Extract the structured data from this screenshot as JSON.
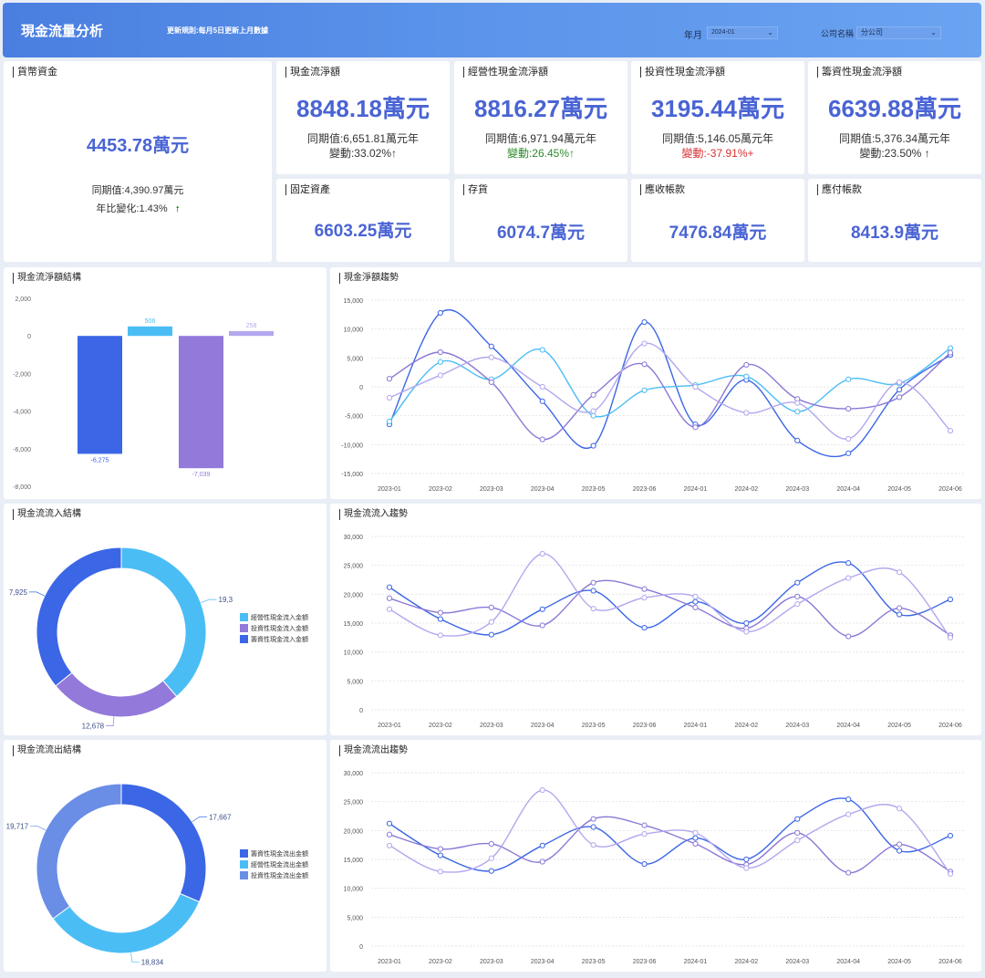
{
  "header": {
    "title": "現金流量分析",
    "update_rule": "更新規則:每月5日更新上月數據",
    "filters": {
      "month_label": "年月",
      "month_value": "2024-01",
      "company_label": "公司名稱",
      "company_value": "分公司"
    }
  },
  "kpis": {
    "cash": {
      "title": "貨幣資金",
      "value": "4453.78萬元",
      "prior": "同期值:4,390.97萬元",
      "change": "年比變化:1.43%",
      "arrow": "🠕"
    },
    "net": {
      "title": "現金流淨額",
      "value": "8848.18萬元",
      "prior": "同期值:6,651.81萬元年",
      "change": "變動:33.02%↑"
    },
    "operating": {
      "title": "經營性現金流淨額",
      "value": "8816.27萬元",
      "prior": "同期值:6,971.94萬元年",
      "change": "變動:26.45%↑"
    },
    "investing": {
      "title": "投資性現金流淨額",
      "value": "3195.44萬元",
      "prior": "同期值:5,146.05萬元年",
      "change": "變動:-37.91%+"
    },
    "financing": {
      "title": "籌資性現金流淨額",
      "value": "6639.88萬元",
      "prior": "同期值:5,376.34萬元年",
      "change": "變動:23.50% ↑"
    },
    "fixed": {
      "title": "固定資產",
      "value": "6603.25萬元"
    },
    "inventory": {
      "title": "存貨",
      "value": "6074.7萬元"
    },
    "receivable": {
      "title": "應收帳款",
      "value": "7476.84萬元"
    },
    "payable": {
      "title": "應付帳款",
      "value": "8413.9萬元"
    }
  },
  "panels": {
    "net_structure": "現金流淨額結構",
    "net_trend": "現金淨額趨勢",
    "inflow_structure": "現金流流入結構",
    "inflow_trend": "現金流流入趨勢",
    "outflow_structure": "現金流流出結構",
    "outflow_trend": "現金流流出趨勢"
  },
  "colors": {
    "blue": "#3b66e6",
    "cyan": "#4bbdf5",
    "purple": "#9279da",
    "lavender": "#b3a7ee",
    "steel": "#6a8ee6"
  },
  "chart_data": [
    {
      "id": "net_structure",
      "type": "bar",
      "values": [
        -6275,
        506,
        -7039,
        258
      ],
      "labels": [
        "-6,275",
        "506",
        "-7,039",
        "258"
      ],
      "colors": [
        "#3b66e6",
        "#4bbdf5",
        "#9279da",
        "#b3a7ee"
      ],
      "yticks": [
        "2,000",
        "0",
        "-2,000",
        "-4,000",
        "-6,000",
        "-8,000"
      ],
      "ylim": [
        -8000,
        2000
      ]
    },
    {
      "id": "net_trend",
      "type": "line",
      "x": [
        "2023-01",
        "2023-02",
        "2023-03",
        "2023-04",
        "2023-05",
        "2023-06",
        "2024-01",
        "2024-02",
        "2024-03",
        "2024-04",
        "2024-05",
        "2024-06"
      ],
      "ylim": [
        -15000,
        15000
      ],
      "yticks": [
        "15,000",
        "10,000",
        "5,000",
        "0",
        "-5,000",
        "-10,000",
        "-15,000"
      ],
      "series": [
        {
          "color": "#3b66e6",
          "values": [
            -6500,
            12800,
            7000,
            -2500,
            -10200,
            11200,
            -6500,
            1200,
            -9300,
            -11500,
            -500,
            5500
          ]
        },
        {
          "color": "#4bbdf5",
          "values": [
            -6000,
            4300,
            1300,
            6400,
            -5000,
            -600,
            300,
            1800,
            -4300,
            1300,
            600,
            6700
          ]
        },
        {
          "color": "#8a78d6",
          "values": [
            1400,
            6000,
            800,
            -9100,
            -1400,
            3900,
            -7000,
            3800,
            -2100,
            -3800,
            -1800,
            5900
          ]
        },
        {
          "color": "#b3a7ee",
          "values": [
            -1900,
            2000,
            5100,
            0,
            -4200,
            7500,
            0,
            -4500,
            -2800,
            -9000,
            800,
            -7600
          ]
        }
      ]
    },
    {
      "id": "inflow_structure",
      "type": "pie",
      "values": [
        19300,
        12678,
        17925
      ],
      "labels": [
        "19,3",
        "12,678",
        "7,925"
      ],
      "colors": [
        "#4bbdf5",
        "#9279da",
        "#3b66e6"
      ],
      "legend": [
        "經營性現金流入金額",
        "投資性現金流入金額",
        "籌資性現金流入金額"
      ]
    },
    {
      "id": "inflow_trend",
      "type": "line",
      "x": [
        "2023-01",
        "2023-02",
        "2023-03",
        "2023-04",
        "2023-05",
        "2023-06",
        "2024-01",
        "2024-02",
        "2024-03",
        "2024-04",
        "2024-05",
        "2024-06"
      ],
      "ylim": [
        0,
        30000
      ],
      "yticks": [
        "30,000",
        "25,000",
        "20,000",
        "15,000",
        "10,000",
        "5,000",
        "0"
      ],
      "series": [
        {
          "color": "#3b66e6",
          "values": [
            21200,
            15700,
            13000,
            17400,
            20600,
            14200,
            18700,
            15000,
            22000,
            25400,
            16500,
            19100
          ]
        },
        {
          "color": "#8a78d6",
          "values": [
            19300,
            16800,
            17700,
            14600,
            22000,
            20900,
            17700,
            14100,
            19600,
            12700,
            17600,
            12900
          ]
        },
        {
          "color": "#b3a7ee",
          "values": [
            17400,
            12900,
            15200,
            27000,
            17500,
            19400,
            19600,
            13500,
            18300,
            22800,
            23800,
            12500
          ]
        }
      ]
    },
    {
      "id": "outflow_structure",
      "type": "pie",
      "values": [
        17667,
        18834,
        19717
      ],
      "labels": [
        "17,667",
        "18,834",
        "19,717"
      ],
      "colors": [
        "#3b66e6",
        "#4bbdf5",
        "#6a8ee6"
      ],
      "legend": [
        "籌資性現金流出金額",
        "經營性現金流出金額",
        "投資性現金流出金額"
      ]
    },
    {
      "id": "outflow_trend",
      "type": "line",
      "x": [
        "2023-01",
        "2023-02",
        "2023-03",
        "2023-04",
        "2023-05",
        "2023-06",
        "2024-01",
        "2024-02",
        "2024-03",
        "2024-04",
        "2024-05",
        "2024-06"
      ],
      "ylim": [
        0,
        30000
      ],
      "yticks": [
        "30,000",
        "25,000",
        "20,000",
        "15,000",
        "10,000",
        "5,000",
        "0"
      ],
      "series": [
        {
          "color": "#3b66e6",
          "values": [
            21200,
            15700,
            13000,
            17400,
            20600,
            14200,
            18700,
            15000,
            22000,
            25400,
            16500,
            19100
          ]
        },
        {
          "color": "#8a78d6",
          "values": [
            19300,
            16800,
            17700,
            14600,
            22000,
            20900,
            17700,
            14100,
            19600,
            12700,
            17600,
            12900
          ]
        },
        {
          "color": "#b3a7ee",
          "values": [
            17400,
            12900,
            15200,
            27000,
            17500,
            19400,
            19600,
            13500,
            18300,
            22800,
            23800,
            12500
          ]
        }
      ]
    }
  ]
}
